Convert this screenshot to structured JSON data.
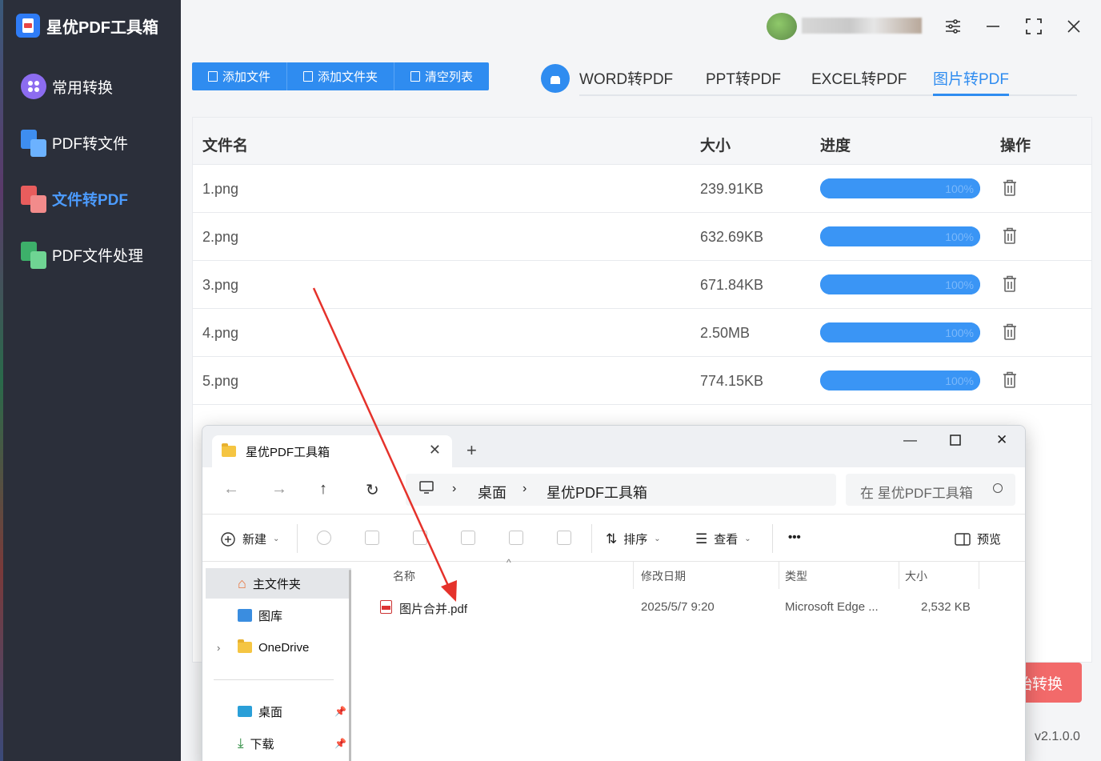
{
  "app": {
    "title": "星优PDF工具箱",
    "version": "v2.1.0.0",
    "start_label": "开始转换",
    "start_visible": "始转换"
  },
  "sidebar": {
    "items": [
      {
        "label": "常用转换"
      },
      {
        "label": "PDF转文件"
      },
      {
        "label": "文件转PDF"
      },
      {
        "label": "PDF文件处理"
      }
    ]
  },
  "toolbar": {
    "add_file": "添加文件",
    "add_folder": "添加文件夹",
    "clear_list": "清空列表"
  },
  "tabs": [
    "WORD转PDF",
    "PPT转PDF",
    "EXCEL转PDF",
    "图片转PDF"
  ],
  "table": {
    "headers": {
      "name": "文件名",
      "size": "大小",
      "progress": "进度",
      "action": "操作"
    },
    "rows": [
      {
        "name": "1.png",
        "size": "239.91KB",
        "progress": "100%",
        "progress_value": 1.0
      },
      {
        "name": "2.png",
        "size": "632.69KB",
        "progress": "100%",
        "progress_value": 1.0
      },
      {
        "name": "3.png",
        "size": "671.84KB",
        "progress": "100%",
        "progress_value": 1.0
      },
      {
        "name": "4.png",
        "size": "2.50MB",
        "progress": "100%",
        "progress_value": 1.0
      },
      {
        "name": "5.png",
        "size": "774.15KB",
        "progress": "100%",
        "progress_value": 1.0
      }
    ]
  },
  "explorer": {
    "tab_title": "星优PDF工具箱",
    "breadcrumb": [
      "桌面",
      "星优PDF工具箱"
    ],
    "search_placeholder": "在 星优PDF工具箱",
    "commands": {
      "new": "新建",
      "sort": "排序",
      "view": "查看",
      "more": "•••",
      "preview": "预览"
    },
    "sidebar": [
      {
        "label": "主文件夹"
      },
      {
        "label": "图库"
      },
      {
        "label": "OneDrive"
      },
      {
        "label": "桌面"
      },
      {
        "label": "下载"
      }
    ],
    "columns": {
      "name": "名称",
      "modified": "修改日期",
      "type": "类型",
      "size": "大小"
    },
    "files": [
      {
        "name": "图片合并.pdf",
        "modified": "2025/5/7 9:20",
        "type": "Microsoft Edge ...",
        "size": "2,532 KB"
      }
    ]
  },
  "colors": {
    "accent": "#2f8cf0",
    "sidebar_bg": "#2b2f3a",
    "start_button": "#f26a6a",
    "arrow": "#e5322b"
  }
}
